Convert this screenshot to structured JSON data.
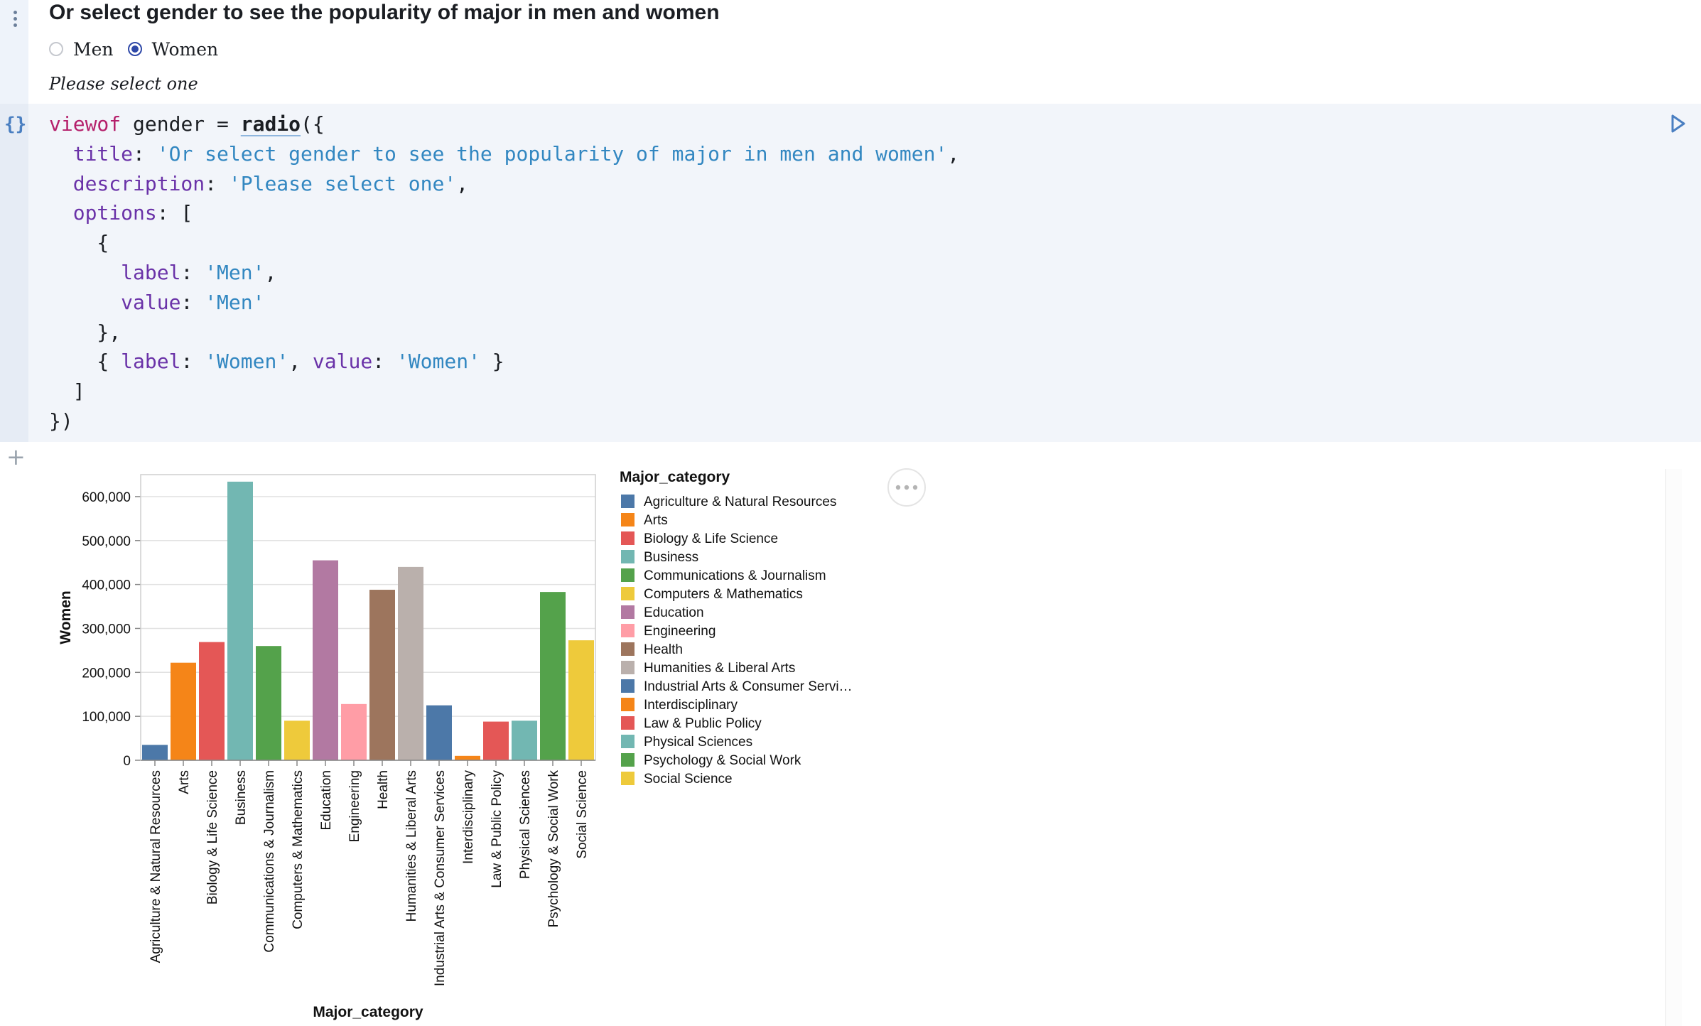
{
  "form": {
    "title": "Or select gender to see the popularity of major in men and women",
    "options": [
      {
        "label": "Men",
        "checked": false
      },
      {
        "label": "Women",
        "checked": true
      }
    ],
    "description": "Please select one"
  },
  "code": {
    "l1": {
      "kw": "viewof",
      "plain": " gender = ",
      "fn": "radio",
      "tail": "({"
    },
    "l2": {
      "prop": "title",
      "str": "'Or select gender to see the popularity of major in men and women'"
    },
    "l3": {
      "prop": "description",
      "str": "'Please select one'"
    },
    "l4": {
      "prop": "options"
    },
    "l6": {
      "prop": "label",
      "str": "'Men'"
    },
    "l7": {
      "prop": "value",
      "str": "'Men'"
    },
    "l9": {
      "prop1": "label",
      "str1": "'Women'",
      "prop2": "value",
      "str2": "'Women'"
    }
  },
  "icons": {
    "menu": "vertical-dots-icon",
    "cell_type": "braces-icon",
    "run": "run-play-icon",
    "add": "plus-icon",
    "chart_menu": "ellipsis-icon"
  },
  "chart_data": {
    "type": "bar",
    "xlabel": "Major_category",
    "ylabel": "Women",
    "ylim": [
      0,
      650000
    ],
    "yticks": [
      0,
      100000,
      200000,
      300000,
      400000,
      500000,
      600000
    ],
    "grid": true,
    "legend_title": "Major_category",
    "legend_position": "right",
    "categories": [
      "Agriculture & Natural Resources",
      "Arts",
      "Biology & Life Science",
      "Business",
      "Communications & Journalism",
      "Computers & Mathematics",
      "Education",
      "Engineering",
      "Health",
      "Humanities & Liberal Arts",
      "Industrial Arts & Consumer Services",
      "Interdisciplinary",
      "Law & Public Policy",
      "Physical Sciences",
      "Psychology & Social Work",
      "Social Science"
    ],
    "legend_labels": [
      "Agriculture & Natural Resources",
      "Arts",
      "Biology & Life Science",
      "Business",
      "Communications & Journalism",
      "Computers & Mathematics",
      "Education",
      "Engineering",
      "Health",
      "Humanities & Liberal Arts",
      "Industrial Arts & Consumer Servi…",
      "Interdisciplinary",
      "Law & Public Policy",
      "Physical Sciences",
      "Psychology & Social Work",
      "Social Science"
    ],
    "values": [
      35000,
      222000,
      269000,
      634000,
      260000,
      90000,
      455000,
      128000,
      388000,
      440000,
      125000,
      10000,
      88000,
      90000,
      383000,
      273000
    ],
    "colors": [
      "#4c78a8",
      "#f58518",
      "#e45756",
      "#72b7b2",
      "#54a24b",
      "#eeca3b",
      "#b279a2",
      "#ff9da6",
      "#9d755d",
      "#bab0ac",
      "#4c78a8",
      "#f58518",
      "#e45756",
      "#72b7b2",
      "#54a24b",
      "#eeca3b"
    ]
  }
}
